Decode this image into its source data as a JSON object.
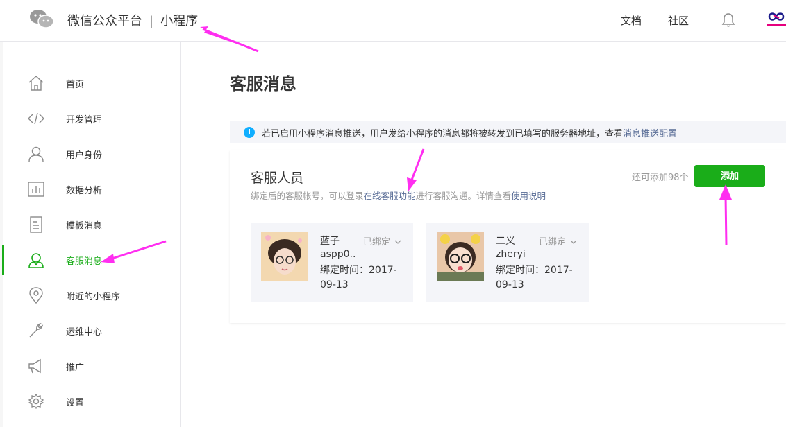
{
  "header": {
    "platform": "微信公众平台",
    "separator": "|",
    "product": "小程序",
    "nav": [
      {
        "label": "文档"
      },
      {
        "label": "社区"
      }
    ]
  },
  "sidebar": {
    "items": [
      {
        "label": "首页",
        "icon": "home-icon"
      },
      {
        "label": "开发管理",
        "icon": "code-icon"
      },
      {
        "label": "用户身份",
        "icon": "user-icon"
      },
      {
        "label": "数据分析",
        "icon": "chart-icon"
      },
      {
        "label": "模板消息",
        "icon": "document-icon"
      },
      {
        "label": "客服消息",
        "icon": "customer-service-icon",
        "active": true
      },
      {
        "label": "附近的小程序",
        "icon": "location-icon"
      },
      {
        "label": "运维中心",
        "icon": "wrench-icon"
      },
      {
        "label": "推广",
        "icon": "megaphone-icon"
      },
      {
        "label": "设置",
        "icon": "gear-icon"
      }
    ]
  },
  "main": {
    "title": "客服消息",
    "notice": {
      "text": "若已启用小程序消息推送，用户发给小程序的消息都将被转发到已填写的服务器地址，查看",
      "link": "消息推送配置"
    },
    "panel": {
      "title": "客服人员",
      "desc_prefix": "绑定后的客服帐号，可以登录",
      "desc_link1": "在线客服功能",
      "desc_middle": "进行客服沟通。详情查看",
      "desc_link2": "使用说明",
      "remaining": "还可添加98个",
      "add_button": "添加",
      "agents": [
        {
          "name": "蓝子",
          "status": "已绑定",
          "account": "aspp0..",
          "time": "绑定时间：2017-09-13"
        },
        {
          "name": "二义",
          "status": "已绑定",
          "account": "zheryi",
          "time": "绑定时间：2017-09-13"
        }
      ]
    }
  },
  "colors": {
    "accent": "#1aad19",
    "link": "#576b95",
    "annotation": "#ff2ef0"
  }
}
